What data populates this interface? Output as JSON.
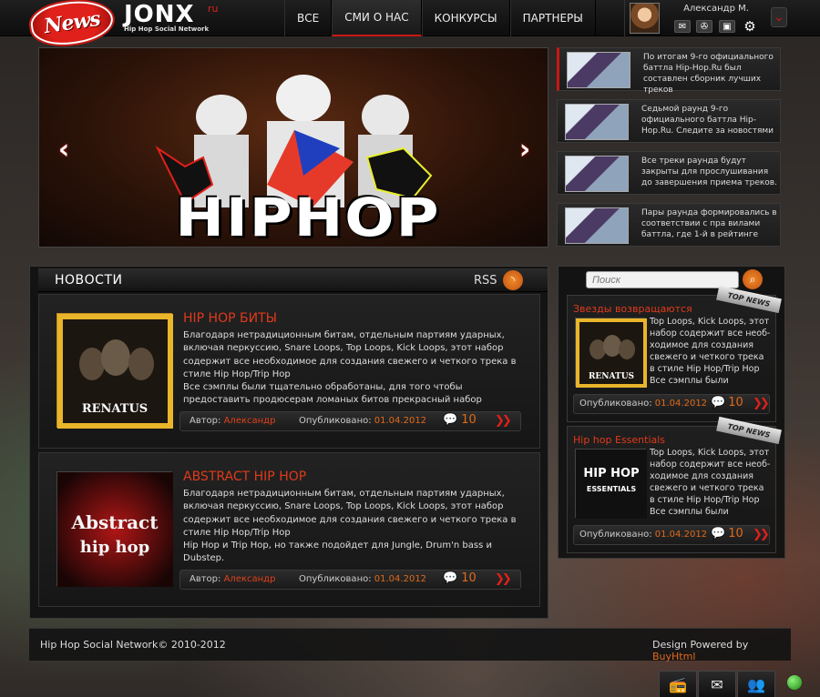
{
  "header": {
    "badge_text": "News",
    "logo": {
      "mark": "JONX",
      "ru": "ru",
      "tagline": "Hip Hop Social Network"
    },
    "nav": [
      "ВСЕ",
      "СМИ О НАС",
      "КОНКУРСЫ",
      "ПАРТНЕРЫ"
    ],
    "active_nav": "СМИ О НАС",
    "user": {
      "name": "Александр М.",
      "icons": [
        "mail-icon",
        "film-reel-icon",
        "photo-icon",
        "gear-icon"
      ]
    }
  },
  "banner": {
    "text": "HIPHOP",
    "prev": "‹",
    "next": "›"
  },
  "side_news": [
    {
      "text": "По итогам 9-го официального баттла Hip-Hop.Ru был составлен сборник лучших треков"
    },
    {
      "text": "Седьмой раунд 9-го официального баттла Hip-Hop.Ru. Следите за новостями"
    },
    {
      "text": "Все треки раунда будут закрыты для прослушивания до завершения приема треков."
    },
    {
      "text": "Пары раунда формировались в соответствии с пра вилами баттла, где 1-й в рейтинге"
    }
  ],
  "news_section": {
    "title": "НОВОСТИ",
    "rss": "RSS"
  },
  "articles": [
    {
      "title": "HIP HOP БИТЫ",
      "body": "Благодаря нетрадиционным битам, отдельным партиям ударных, включая перкуссию, Snare Loops, Top Loops, Kick Loops, этот набор содержит все необходимое для создания свежего и четкого трека в стиле Hip Hop/Trip Hop\nВсе сэмплы были тщательно обработаны, для того чтобы предоставить продюсерам ломаных битов прекрасный набор сэмплов. Набор специ-",
      "author_label": "Автор:",
      "author": "Александр",
      "published_label": "Опубликовано:",
      "date": "01.04.2012",
      "comments": "10",
      "cover_text": "HIP HOP RENATUS"
    },
    {
      "title": "ABSTRACT HIP HOP",
      "body": "Благодаря нетрадиционным битам, отдельным партиям ударных, включая перкуссию, Snare Loops, Top Loops, Kick Loops, этот набор содержит все необходимое для создания свежего и четкого трека в стиле Hip Hop/Trip Hop\nHip Hop и Trip Hop, но также подойдет для Jungle, Drum'n bass и Dubstep.",
      "author_label": "Автор:",
      "author": "Александр",
      "published_label": "Опубликовано:",
      "date": "01.04.2012",
      "comments": "10",
      "cover_text": "Abstract hip hop"
    }
  ],
  "search": {
    "placeholder": "Поиск"
  },
  "top_news": [
    {
      "ribbon": "TOP NEWS",
      "title": "Звезды возвращаются",
      "body": "Top Loops, Kick Loops, этот набор содержит все необ-ходимое для создания свежего и четкого трека в стиле Hip Hop/Trip Hop Все сэмплы были тщатель-",
      "published_label": "Опубликовано:",
      "date": "01.04.2012",
      "comments": "10",
      "cover_text": "HIP HOP RENATUS"
    },
    {
      "ribbon": "TOP NEWS",
      "title": "Hip hop Essentials",
      "body": "Top Loops, Kick Loops, этот набор содержит все необ-ходимое для создания свежего и четкого трека в стиле Hip Hop/Trip Hop Все сэмплы были тщатель-",
      "published_label": "Опубликовано:",
      "date": "01.04.2012",
      "comments": "10",
      "cover_text": "HIP HOP ESSENTIALS"
    }
  ],
  "footer": {
    "copyright": "Hip Hop Social Network© 2010-2012",
    "powered_prefix": "Design Powered by ",
    "powered_brand": "BuyHtml"
  },
  "dock": {
    "icons": [
      "radio-icon",
      "mail-icon",
      "users-icon",
      "online-status-icon"
    ]
  }
}
